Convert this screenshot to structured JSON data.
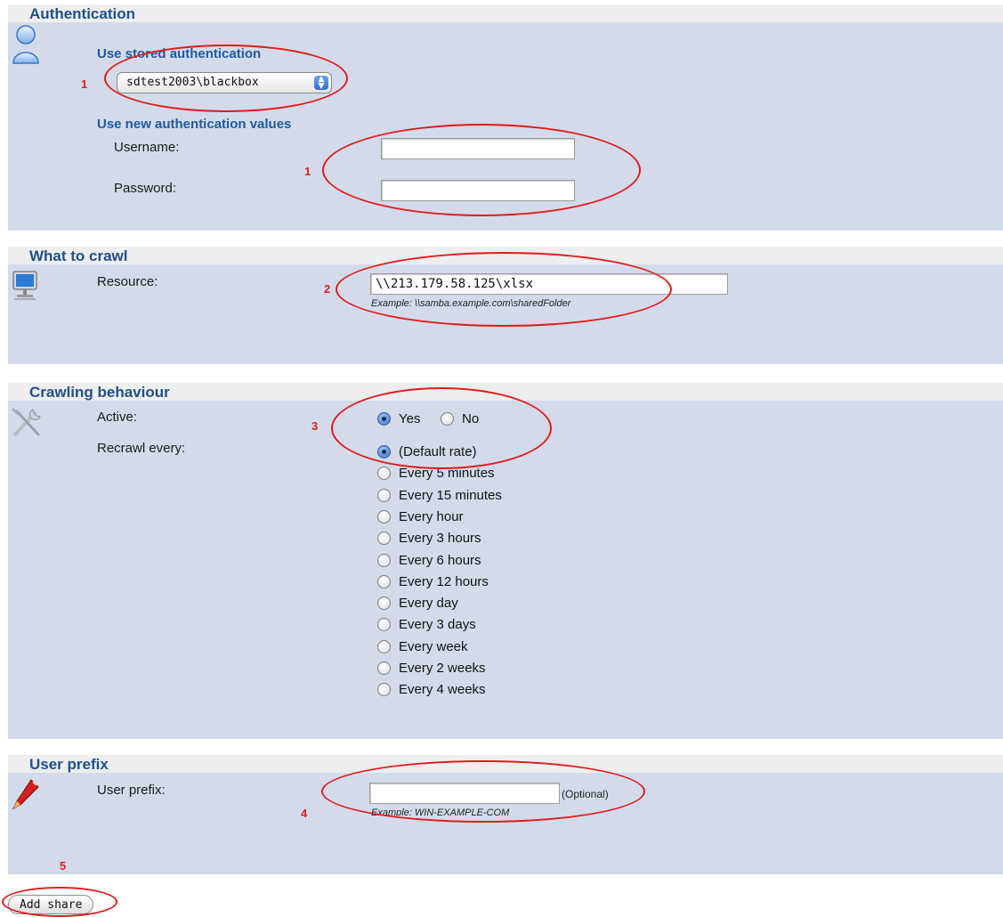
{
  "auth": {
    "title": "Authentication",
    "stored_label": "Use stored authentication",
    "stored_value": "sdtest2003\\blackbox",
    "new_label": "Use new authentication values",
    "username_label": "Username:",
    "username_value": "",
    "password_label": "Password:",
    "password_value": "",
    "mark_select": "1",
    "mark_fields": "1"
  },
  "crawl": {
    "title": "What to crawl",
    "resource_label": "Resource:",
    "resource_value": "\\\\213.179.58.125\\xlsx",
    "example": "Example: \\\\samba.example.com\\sharedFolder",
    "mark": "2"
  },
  "behaviour": {
    "title": "Crawling behaviour",
    "active_label": "Active:",
    "active_yes": "Yes",
    "active_no": "No",
    "active_selected": "Yes",
    "recrawl_label": "Recrawl every:",
    "recrawl_options": [
      "(Default rate)",
      "Every 5 minutes",
      "Every 15 minutes",
      "Every hour",
      "Every 3 hours",
      "Every 6 hours",
      "Every 12 hours",
      "Every day",
      "Every 3 days",
      "Every week",
      "Every 2 weeks",
      "Every 4 weeks"
    ],
    "recrawl_selected": "(Default rate)",
    "mark": "3"
  },
  "prefix": {
    "title": "User prefix",
    "label": "User prefix:",
    "value": "",
    "optional": "(Optional)",
    "example": "Example: WIN-EXAMPLE-COM",
    "mark": "4"
  },
  "actions": {
    "add_share": "Add share",
    "mark": "5"
  },
  "colors": {
    "section_title": "#1f4f8c",
    "section_body": "#d3dbeb",
    "annotation_red": "#e41a1a"
  },
  "icons": {
    "auth": "user-icon",
    "crawl": "computer-icon",
    "behaviour": "tools-icon",
    "prefix": "pen-icon"
  }
}
